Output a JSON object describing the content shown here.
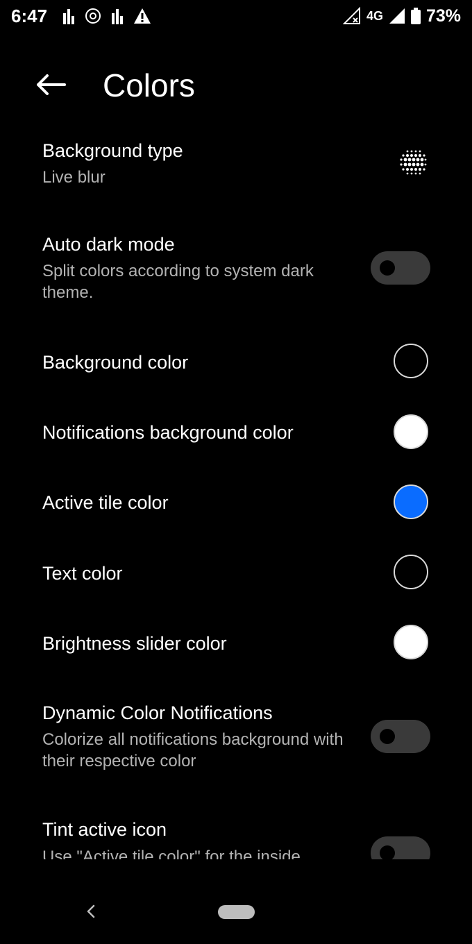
{
  "status_bar": {
    "time": "6:47",
    "network": "4G",
    "battery": "73%"
  },
  "app_bar": {
    "title": "Colors",
    "back_icon": "arrow-left-icon"
  },
  "settings": {
    "background_type": {
      "title": "Background type",
      "value": "Live blur",
      "icon": "dots-grid-icon"
    },
    "auto_dark_mode": {
      "title": "Auto dark mode",
      "subtitle": "Split colors according to system dark theme.",
      "enabled": false
    },
    "background_color": {
      "title": "Background color",
      "color": "#000000"
    },
    "notifications_background_color": {
      "title": "Notifications background color",
      "color": "#ffffff"
    },
    "active_tile_color": {
      "title": "Active tile color",
      "color": "#0a6cff"
    },
    "text_color": {
      "title": "Text color",
      "color": "#000000"
    },
    "brightness_slider_color": {
      "title": "Brightness slider color",
      "color": "#ffffff"
    },
    "dynamic_color_notifications": {
      "title": "Dynamic Color Notifications",
      "subtitle": "Colorize all notifications background with their respective color",
      "enabled": false
    },
    "tint_active_icon": {
      "title": "Tint active icon",
      "subtitle": "Use \"Active tile color\" for the inside",
      "enabled": false
    }
  },
  "nav_bar": {
    "back_icon": "chevron-left-icon",
    "home_icon": "home-pill-icon"
  }
}
